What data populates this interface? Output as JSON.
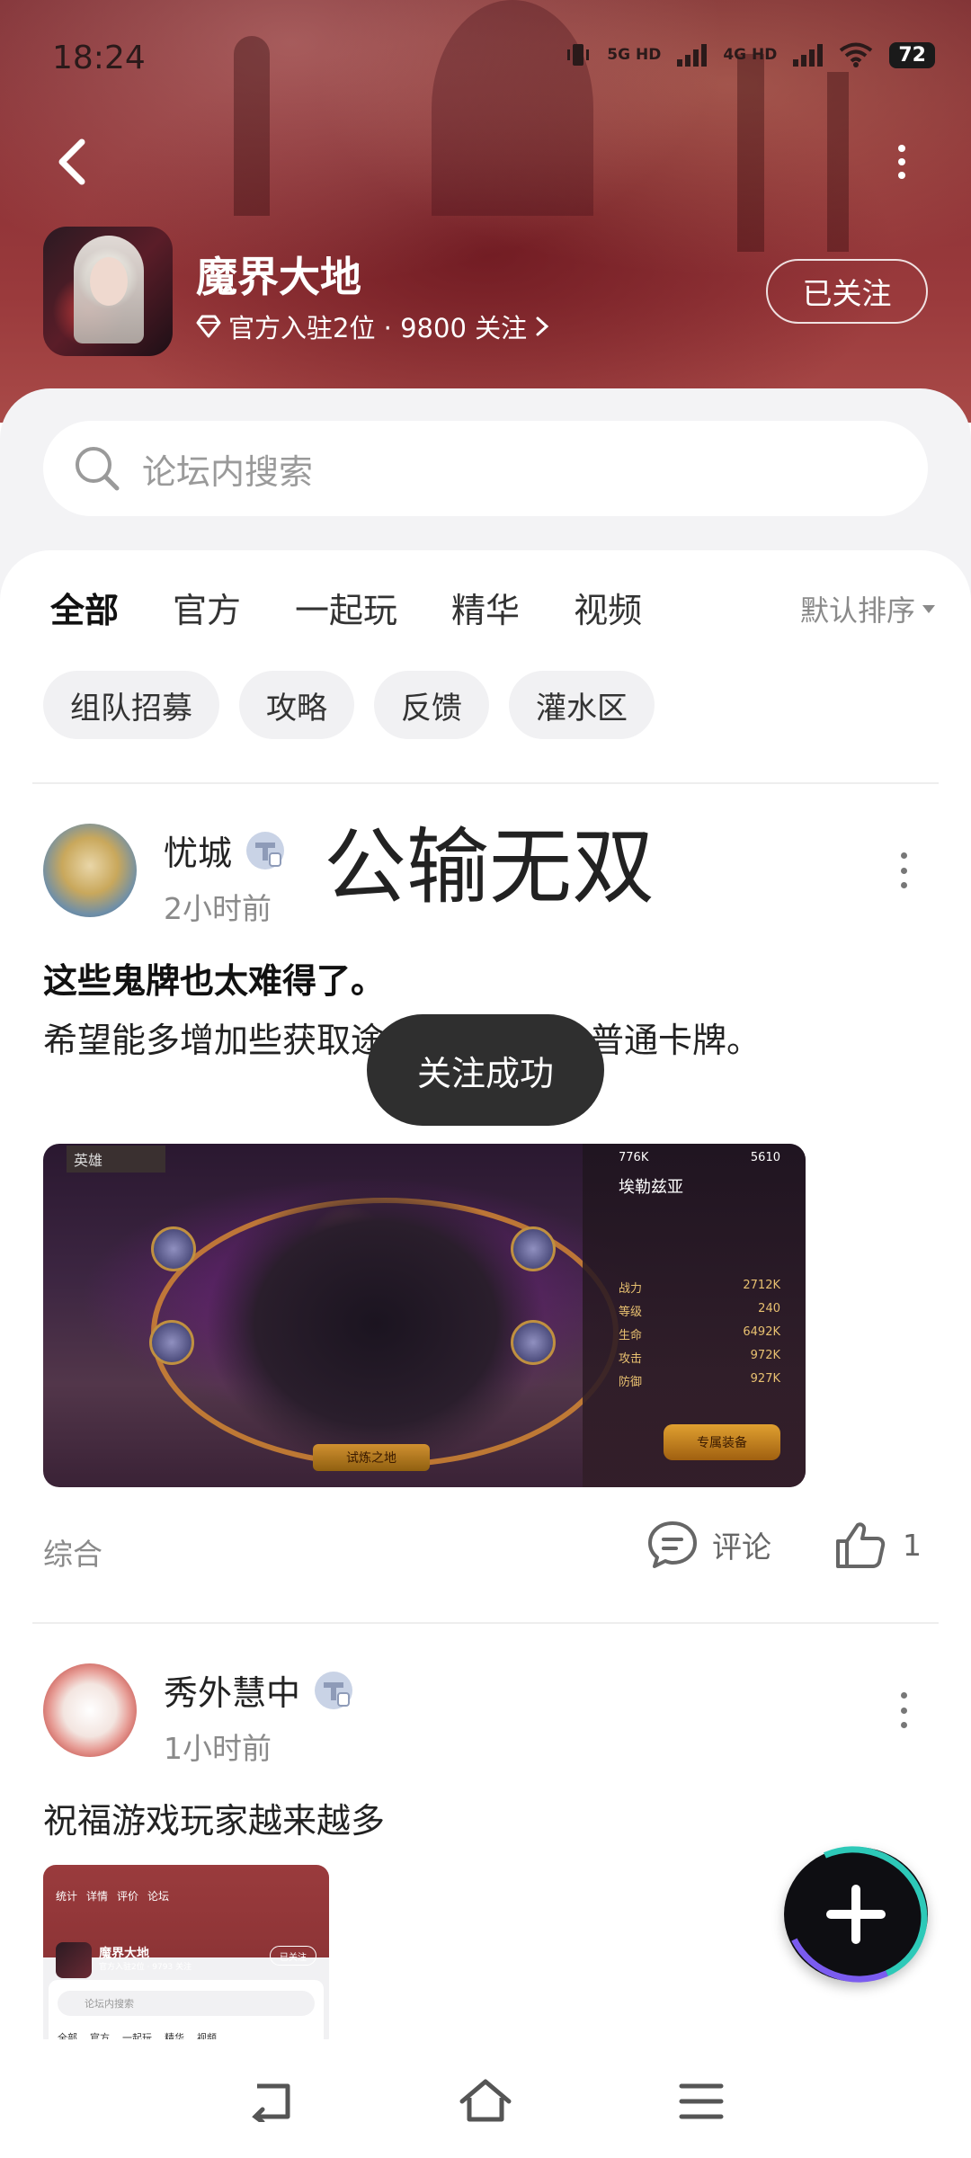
{
  "status_bar": {
    "time": "18:24",
    "network1": "5G HD",
    "network2": "4G HD",
    "battery": "72"
  },
  "header": {
    "game_name": "魔界大地",
    "meta": "官方入驻2位 · 9800 关注",
    "follow_label": "已关注"
  },
  "search": {
    "placeholder": "论坛内搜索"
  },
  "tabs": [
    "全部",
    "官方",
    "一起玩",
    "精华",
    "视频"
  ],
  "sort_label": "默认排序",
  "chips": [
    "组队招募",
    "攻略",
    "反馈",
    "灌水区"
  ],
  "posts": [
    {
      "author": "忧城",
      "time": "2小时前",
      "headline": "公输无双",
      "title": "这些鬼牌也太难得了。",
      "body": "希望能多增加些获取途径，别老是给普通卡牌。",
      "image": {
        "header": "英雄",
        "name": "埃勒兹亚",
        "power_label": "战力",
        "power": "2712K",
        "level_label": "等级",
        "level": "240",
        "life_label": "生命",
        "life": "6492K",
        "attack_label": "攻击",
        "attack": "972K",
        "defense_label": "防御",
        "defense": "927K",
        "gold": "776K",
        "gems": "5610",
        "equip_button": "专属装备",
        "trial_button": "试炼之地"
      },
      "category": "综合",
      "comment_label": "评论",
      "likes": "1"
    },
    {
      "author": "秀外慧中",
      "time": "1小时前",
      "title": "祝福游戏玩家越来越多",
      "image": {
        "nav": [
          "统计",
          "详情",
          "评价",
          "论坛"
        ],
        "game_name": "魔界大地",
        "meta": "官方入驻2位 · 9793 关注",
        "follow_label": "已关注",
        "search_placeholder": "论坛内搜索",
        "tabs": [
          "全部",
          "官方",
          "一起玩",
          "精华",
          "视频"
        ]
      }
    }
  ],
  "toast": "关注成功"
}
